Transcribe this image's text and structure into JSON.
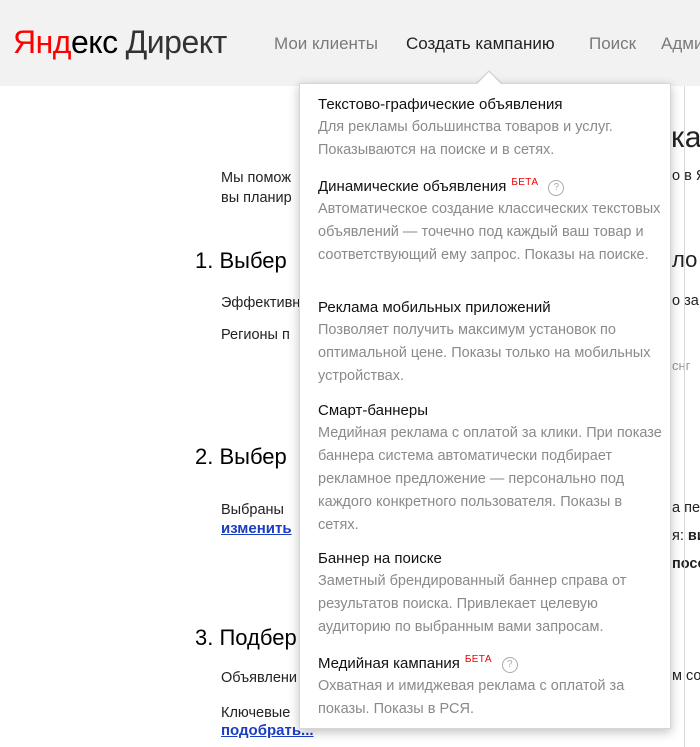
{
  "header": {
    "logo_yandex_a": "Янд",
    "logo_yandex_b": "екс",
    "logo_product": "Директ",
    "nav": [
      {
        "label": "Мои клиенты"
      },
      {
        "label": "Создать кампанию"
      },
      {
        "label": "Поиск"
      },
      {
        "label": "Адми"
      }
    ]
  },
  "background": {
    "title_fragment": "ка",
    "intro_line1": "Мы помож",
    "intro_line2": "вы планир",
    "intro_right": "о в Я",
    "step1_heading": "1. Выбер",
    "step1_heading_right": "ло",
    "step1_row1": "Эффективн",
    "step1_row1_right": "о за",
    "step1_row2": "Регионы п",
    "step1_row3_right": "снг",
    "step2_heading": "2. Выбер",
    "step2_row1": "Выбраны",
    "step2_row1_right": "а пе",
    "step2_link": "изменить",
    "step2_row2_right_a": "я:",
    "step2_row2_right_b": "ви",
    "step2_row3_right": "посо",
    "step3_heading": "3. Подбер",
    "step3_row1": "Объявлени",
    "step3_row1_right": "м со",
    "step3_row2": "Ключевые",
    "step3_link": "подобрать..."
  },
  "dropdown": {
    "items": [
      {
        "title": "Текстово-графические объявления",
        "badge": "",
        "desc": "Для рекламы большинства товаров и услуг. Показываются на поиске и в сетях."
      },
      {
        "title": "Динамические объявления",
        "badge": "БЕТА",
        "help": "?",
        "desc": "Автоматическое создание классических текстовых объявлений — точечно под каждый ваш товар и соответствующий ему запрос. Показы на поиске."
      },
      {
        "title": "Реклама мобильных приложений",
        "badge": "",
        "desc": "Позволяет получить максимум установок по оптимальной цене. Показы только на мобильных устройствах."
      },
      {
        "title": "Смарт-баннеры",
        "badge": "",
        "desc": "Медийная реклама с оплатой за клики. При показе баннера система автоматически подбирает рекламное предложение — персонально под каждого конкретного пользователя. Показы в сетях."
      },
      {
        "title": "Баннер на поиске",
        "badge": "",
        "desc": "Заметный брендированный баннер справа от результатов поиска. Привлекает целевую аудиторию по выбранным вами запросам."
      },
      {
        "title": "Медийная кампания",
        "badge": "БЕТА",
        "help": "?",
        "desc": "Охватная и имиджевая реклама с оплатой за показы. Показы в РСЯ."
      }
    ]
  }
}
